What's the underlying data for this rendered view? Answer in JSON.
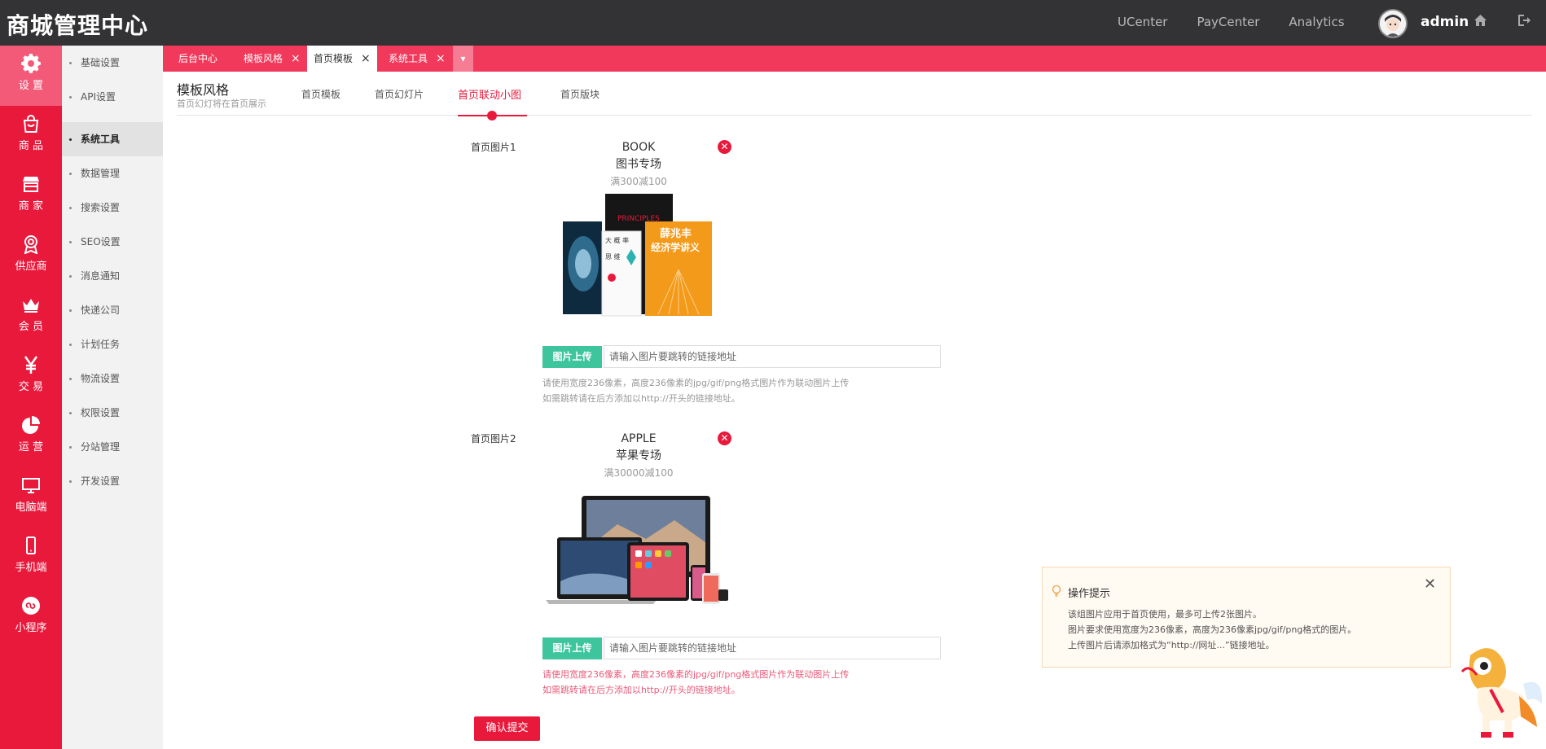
{
  "header": {
    "logo": "商城管理中心",
    "nav": [
      "UCenter",
      "PayCenter",
      "Analytics"
    ],
    "username": "admin",
    "icons": [
      "home-icon",
      "logout-icon"
    ]
  },
  "rail": [
    {
      "label": "设 置",
      "icon": "gear-icon",
      "active": true
    },
    {
      "label": "商 品",
      "icon": "shopping-bag-icon"
    },
    {
      "label": "商 家",
      "icon": "store-icon"
    },
    {
      "label": "供应商",
      "icon": "badge-icon"
    },
    {
      "label": "会 员",
      "icon": "crown-icon"
    },
    {
      "label": "交 易",
      "icon": "yen-icon"
    },
    {
      "label": "运 营",
      "icon": "pie-chart-icon"
    },
    {
      "label": "电脑端",
      "icon": "monitor-icon"
    },
    {
      "label": "手机端",
      "icon": "mobile-icon"
    },
    {
      "label": "小程序",
      "icon": "mini-program-icon"
    }
  ],
  "submenu": [
    "基础设置",
    "API设置",
    "系统工具",
    "数据管理",
    "搜索设置",
    "SEO设置",
    "消息通知",
    "快递公司",
    "计划任务",
    "物流设置",
    "权限设置",
    "分站管理",
    "开发设置"
  ],
  "submenu_active": "系统工具",
  "tabs": [
    {
      "label": "后台中心",
      "closable": false
    },
    {
      "label": "模板风格",
      "closable": true
    },
    {
      "label": "首页模板",
      "closable": true,
      "active": true
    },
    {
      "label": "系统工具",
      "closable": true
    }
  ],
  "tab_more": "▾",
  "close_glyph": "×",
  "page": {
    "title": "模板风格",
    "subtitle": "首页幻灯将在首页展示",
    "subtabs": [
      "首页模板",
      "首页幻灯片",
      "首页联动小图",
      "首页版块"
    ],
    "active_subtab": "首页联动小图"
  },
  "images": [
    {
      "label": "首页图片1",
      "title": "BOOK",
      "subtitle": "图书专场",
      "promo": "满300减100",
      "upload_label": "图片上传",
      "link_placeholder": "请输入图片要跳转的链接地址",
      "hint1": "请使用宽度236像素，高度236像素的jpg/gif/png格式图片作为联动图片上传",
      "hint2": "如需跳转请在后方添加以http://开头的链接地址。",
      "book_texts": {
        "principles": "PRINCIPLES",
        "concept": "大 概 率",
        "thinking": "思 维",
        "author": "薛兆丰",
        "econ": "经济学讲义"
      }
    },
    {
      "label": "首页图片2",
      "title": "APPLE",
      "subtitle": "苹果专场",
      "promo": "满30000减100",
      "upload_label": "图片上传",
      "link_placeholder": "请输入图片要跳转的链接地址",
      "hint1": "请使用宽度236像素，高度236像素的jpg/gif/png格式图片作为联动图片上传",
      "hint2": "如需跳转请在后方添加以http://开头的链接地址。"
    }
  ],
  "delete_glyph": "✕",
  "submit_label": "确认提交",
  "tips": {
    "title": "操作提示",
    "close_glyph": "✕",
    "lines": [
      "该组图片应用于首页使用，最多可上传2张图片。",
      "图片要求使用宽度为236像素，高度为236像素jpg/gif/png格式的图片。",
      "上传图片后请添加格式为“http://网址...”链接地址。"
    ]
  },
  "colors": {
    "accent": "#e9193c",
    "upload": "#3fc59d",
    "header": "#333335"
  }
}
